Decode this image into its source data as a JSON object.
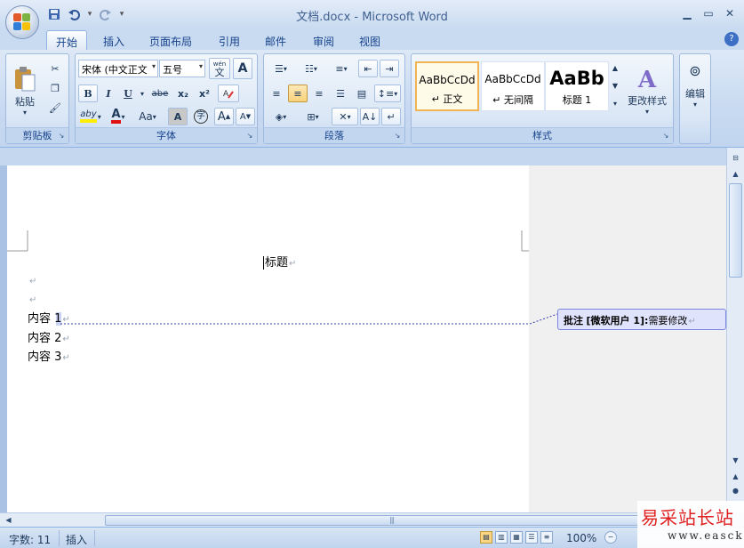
{
  "window": {
    "title": "文档.docx - Microsoft Word"
  },
  "qat": {
    "save_icon": "save-icon",
    "undo_icon": "undo-icon",
    "redo_icon": "redo-icon"
  },
  "tabs": [
    {
      "label": "开始",
      "active": true
    },
    {
      "label": "插入"
    },
    {
      "label": "页面布局"
    },
    {
      "label": "引用"
    },
    {
      "label": "邮件"
    },
    {
      "label": "审阅"
    },
    {
      "label": "视图"
    }
  ],
  "ribbon": {
    "clipboard": {
      "paste_label": "粘贴",
      "group_label": "剪贴板"
    },
    "font": {
      "font_name": "宋体 (中文正文",
      "font_size": "五号",
      "group_label": "字体",
      "grow_label": "A",
      "shrink_label": "A",
      "case_label": "Aa",
      "bold": "B",
      "italic": "I",
      "underline": "U",
      "strike": "abe",
      "subscript": "x₂",
      "superscript": "x²",
      "wen": "wén\n文",
      "char_border": "A",
      "highlight": "aby",
      "font_color": "A",
      "char_shade": "A",
      "enclose": "字"
    },
    "paragraph": {
      "group_label": "段落"
    },
    "styles": {
      "group_label": "样式",
      "items": [
        {
          "sample": "AaBbCcDd",
          "name": "↵ 正文"
        },
        {
          "sample": "AaBbCcDd",
          "name": "↵ 无间隔"
        },
        {
          "sample": "AaBb",
          "name": "标题 1"
        }
      ],
      "change_styles_label": "更改样式"
    },
    "editing": {
      "label": "编辑"
    }
  },
  "document": {
    "lines": [
      {
        "text": "标题",
        "mark": "↵"
      },
      {
        "text": "",
        "mark": "↵"
      },
      {
        "text": "",
        "mark": "↵"
      },
      {
        "text": "内容 1",
        "mark": "↵"
      },
      {
        "text": "内容 2",
        "mark": "↵"
      },
      {
        "text": "内容 3",
        "mark": "↵"
      }
    ],
    "comment": {
      "prefix": "批注",
      "author": "[微软用户 1]:",
      "text": "需要修改",
      "mark": "↵"
    }
  },
  "statusbar": {
    "word_count": "字数: 11",
    "mode": "插入",
    "zoom": "100%"
  },
  "watermark": {
    "cn": "易采站长站",
    "en": "www.easck.com"
  },
  "colors": {
    "accent": "#15428b",
    "comment_border": "#7b84e0",
    "comment_bg": "#dfe3fb"
  }
}
